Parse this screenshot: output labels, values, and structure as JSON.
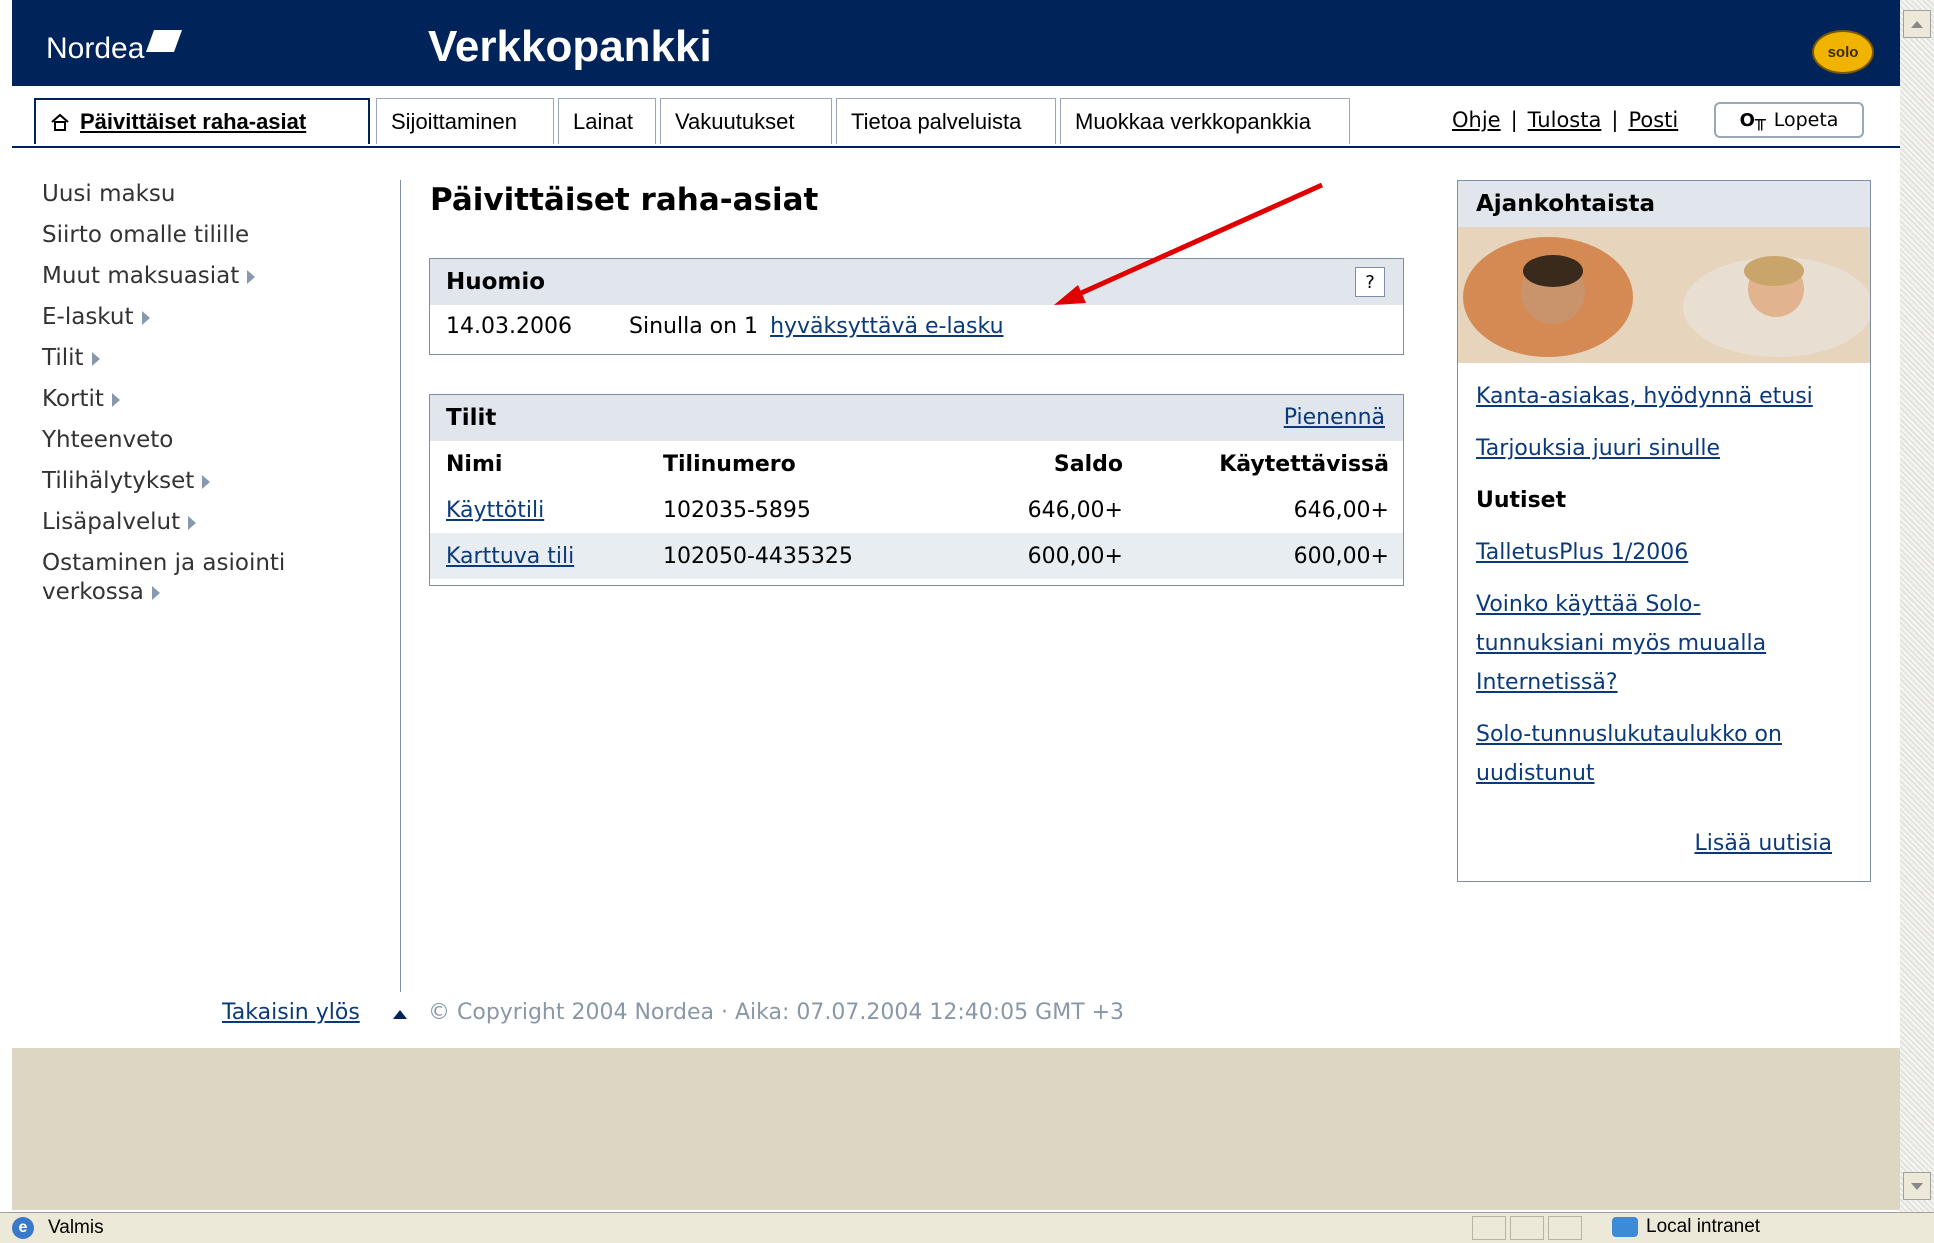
{
  "header": {
    "logo_text": "Nordea",
    "app_title": "Verkkopankki",
    "solo_badge": "solo"
  },
  "tabs": [
    {
      "label": "Päivittäiset raha-asiat",
      "active": true
    },
    {
      "label": "Sijoittaminen"
    },
    {
      "label": "Lainat"
    },
    {
      "label": "Vakuutukset"
    },
    {
      "label": "Tietoa palveluista"
    },
    {
      "label": "Muokkaa verkkopankkia"
    }
  ],
  "toplinks": {
    "help": "Ohje",
    "print": "Tulosta",
    "mail": "Posti",
    "logout": "Lopeta"
  },
  "leftnav": [
    {
      "label": "Uusi maksu"
    },
    {
      "label": "Siirto omalle tilille"
    },
    {
      "label": "Muut maksuasiat"
    },
    {
      "label": "E-laskut"
    },
    {
      "label": "Tilit"
    },
    {
      "label": "Kortit"
    },
    {
      "label": "Yhteenveto"
    },
    {
      "label": "Tilihälytykset"
    },
    {
      "label": "Lisäpalvelut"
    },
    {
      "label": "Ostaminen ja asiointi"
    },
    {
      "label": "verkossa"
    }
  ],
  "main": {
    "title": "Päivittäiset raha-asiat",
    "notice": {
      "heading": "Huomio",
      "help": "?",
      "date": "14.03.2006",
      "text": "Sinulla on 1",
      "link": "hyväksyttävä e-lasku"
    },
    "accounts": {
      "heading": "Tilit",
      "toggle": "Pienennä",
      "columns": [
        "Nimi",
        "Tilinumero",
        "Saldo",
        "Käytettävissä"
      ],
      "rows": [
        {
          "name": "Käyttötili",
          "number": "102035-5895",
          "balance": "646,00+",
          "available": "646,00+"
        },
        {
          "name": "Karttuva tili",
          "number": "102050-4435325",
          "balance": "600,00+",
          "available": "600,00+"
        }
      ]
    }
  },
  "sidebar_right": {
    "heading": "Ajankohtaista",
    "links": [
      {
        "text": "Kanta-asiakas, hyödynnä etusi",
        "link": true
      },
      {
        "text": "Tarjouksia juuri sinulle",
        "link": true
      },
      {
        "text": "Uutiset",
        "link": false
      },
      {
        "text": "TalletusPlus 1/2006",
        "link": true
      },
      {
        "text": "Voinko käyttää Solo-tunnuksiani myös muualla Internetissä?",
        "link": true
      },
      {
        "text": "Solo-tunnuslukutaulukko on uudistunut",
        "link": true
      }
    ],
    "more": "Lisää uutisia"
  },
  "footer": {
    "back_to_top": "Takaisin ylös",
    "copyright": "© Copyright 2004 Nordea · Aika: 07.07.2004 12:40:05 GMT +3"
  },
  "statusbar": {
    "status": "Valmis",
    "zone": "Local intranet"
  },
  "colors": {
    "brand_navy": "#00235a",
    "accent_red": "#e00000",
    "panel_head": "#e1e6ec",
    "beige": "#dcd7c3"
  }
}
